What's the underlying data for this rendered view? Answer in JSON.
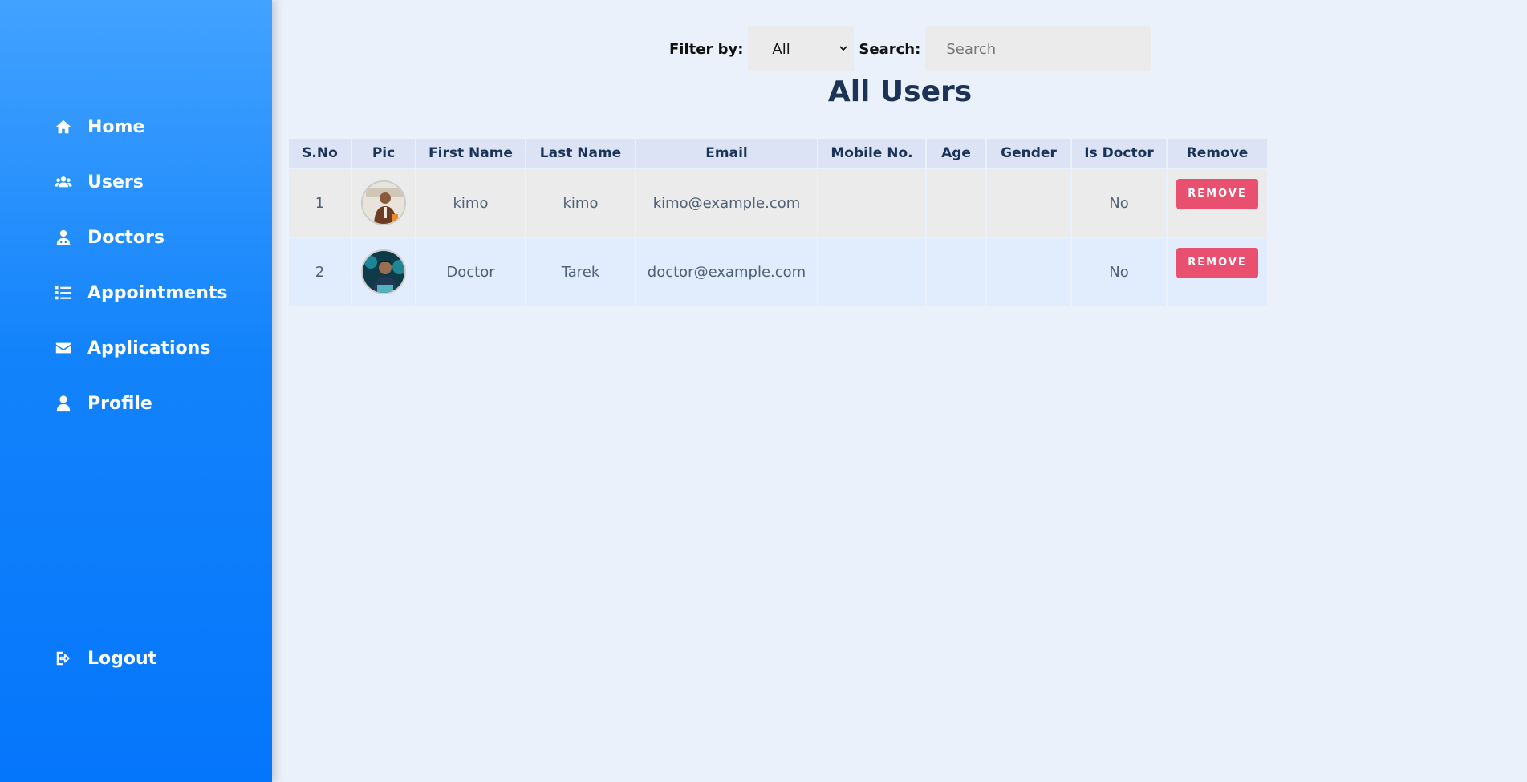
{
  "sidebar": {
    "items": [
      {
        "label": "Home",
        "icon": "home-icon"
      },
      {
        "label": "Users",
        "icon": "users-icon"
      },
      {
        "label": "Doctors",
        "icon": "doctor-icon"
      },
      {
        "label": "Appointments",
        "icon": "list-icon"
      },
      {
        "label": "Applications",
        "icon": "envelope-icon"
      },
      {
        "label": "Profile",
        "icon": "user-icon"
      }
    ],
    "logout": {
      "label": "Logout",
      "icon": "logout-icon"
    }
  },
  "filters": {
    "filter_label": "Filter by:",
    "filter_value": "All",
    "search_label": "Search:",
    "search_placeholder": "Search",
    "search_value": ""
  },
  "title": "All Users",
  "table": {
    "headers": [
      "S.No",
      "Pic",
      "First Name",
      "Last Name",
      "Email",
      "Mobile No.",
      "Age",
      "Gender",
      "Is Doctor",
      "Remove"
    ],
    "rows": [
      {
        "sno": "1",
        "first": "kimo",
        "last": "kimo",
        "email": "kimo@example.com",
        "mobile": "",
        "age": "",
        "gender": "",
        "is_doctor": "No",
        "remove": "REMOVE"
      },
      {
        "sno": "2",
        "first": "Doctor",
        "last": "Tarek",
        "email": "doctor@example.com",
        "mobile": "",
        "age": "",
        "gender": "",
        "is_doctor": "No",
        "remove": "REMOVE"
      }
    ]
  },
  "colors": {
    "sidebar_top": "#42a2ff",
    "sidebar_bottom": "#0476fb",
    "title": "#1b3357",
    "remove_button": "#e9506f"
  }
}
